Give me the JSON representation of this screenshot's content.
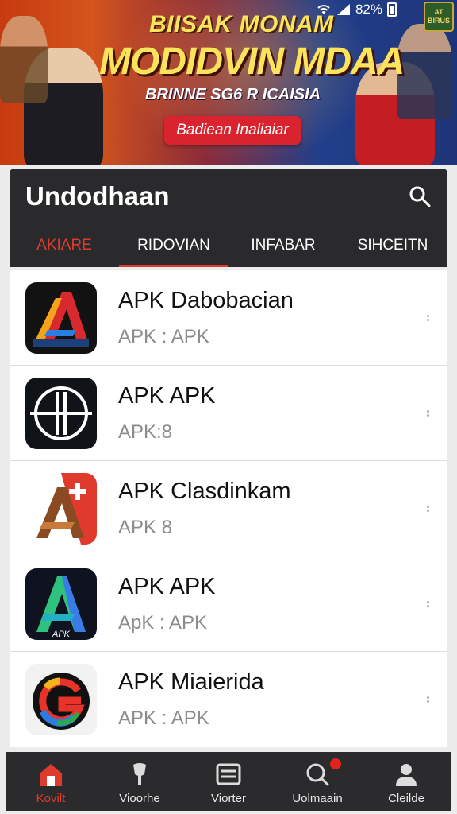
{
  "status_bar": {
    "battery": "82%"
  },
  "banner": {
    "line1": "BIISAK MONAM",
    "line2": "MODIDVIN MDAA",
    "line3": "BRINNE SG6 R ICAISIA",
    "cta": "Badiean Inaliaiar",
    "badge": "AT BIRUS"
  },
  "header": {
    "title": "Undodhaan",
    "tabs": [
      {
        "label": "AKIARE",
        "active": true
      },
      {
        "label": "RIDOVIAN"
      },
      {
        "label": "INFABAR"
      },
      {
        "label": "SIHCEITN"
      }
    ]
  },
  "apps": [
    {
      "title": "APK Dabobacian",
      "subtitle": "APK : APK",
      "icon": "letter-a-red-icon"
    },
    {
      "title": "APK APK",
      "subtitle": "APK:8",
      "icon": "circle-target-icon"
    },
    {
      "title": "APK Clasdinkam",
      "subtitle": "APK 8",
      "icon": "letter-a-plus-icon"
    },
    {
      "title": "APK APK",
      "subtitle": "ApK : APK",
      "icon": "letter-a-green-icon"
    },
    {
      "title": "APK Miaierida",
      "subtitle": "APK : APK",
      "icon": "letter-g-icon"
    }
  ],
  "bottom_nav": [
    {
      "label": "Kovilt",
      "icon": "home-icon",
      "active": true
    },
    {
      "label": "Vioorhe",
      "icon": "shovel-icon"
    },
    {
      "label": "Viorter",
      "icon": "list-icon"
    },
    {
      "label": "Uolmaain",
      "icon": "search-icon",
      "badge": true
    },
    {
      "label": "Cleilde",
      "icon": "profile-icon"
    }
  ],
  "colors": {
    "accent": "#e03a2c",
    "header_bg": "#2a2a2c",
    "nav_bg": "#2b2b2d"
  }
}
